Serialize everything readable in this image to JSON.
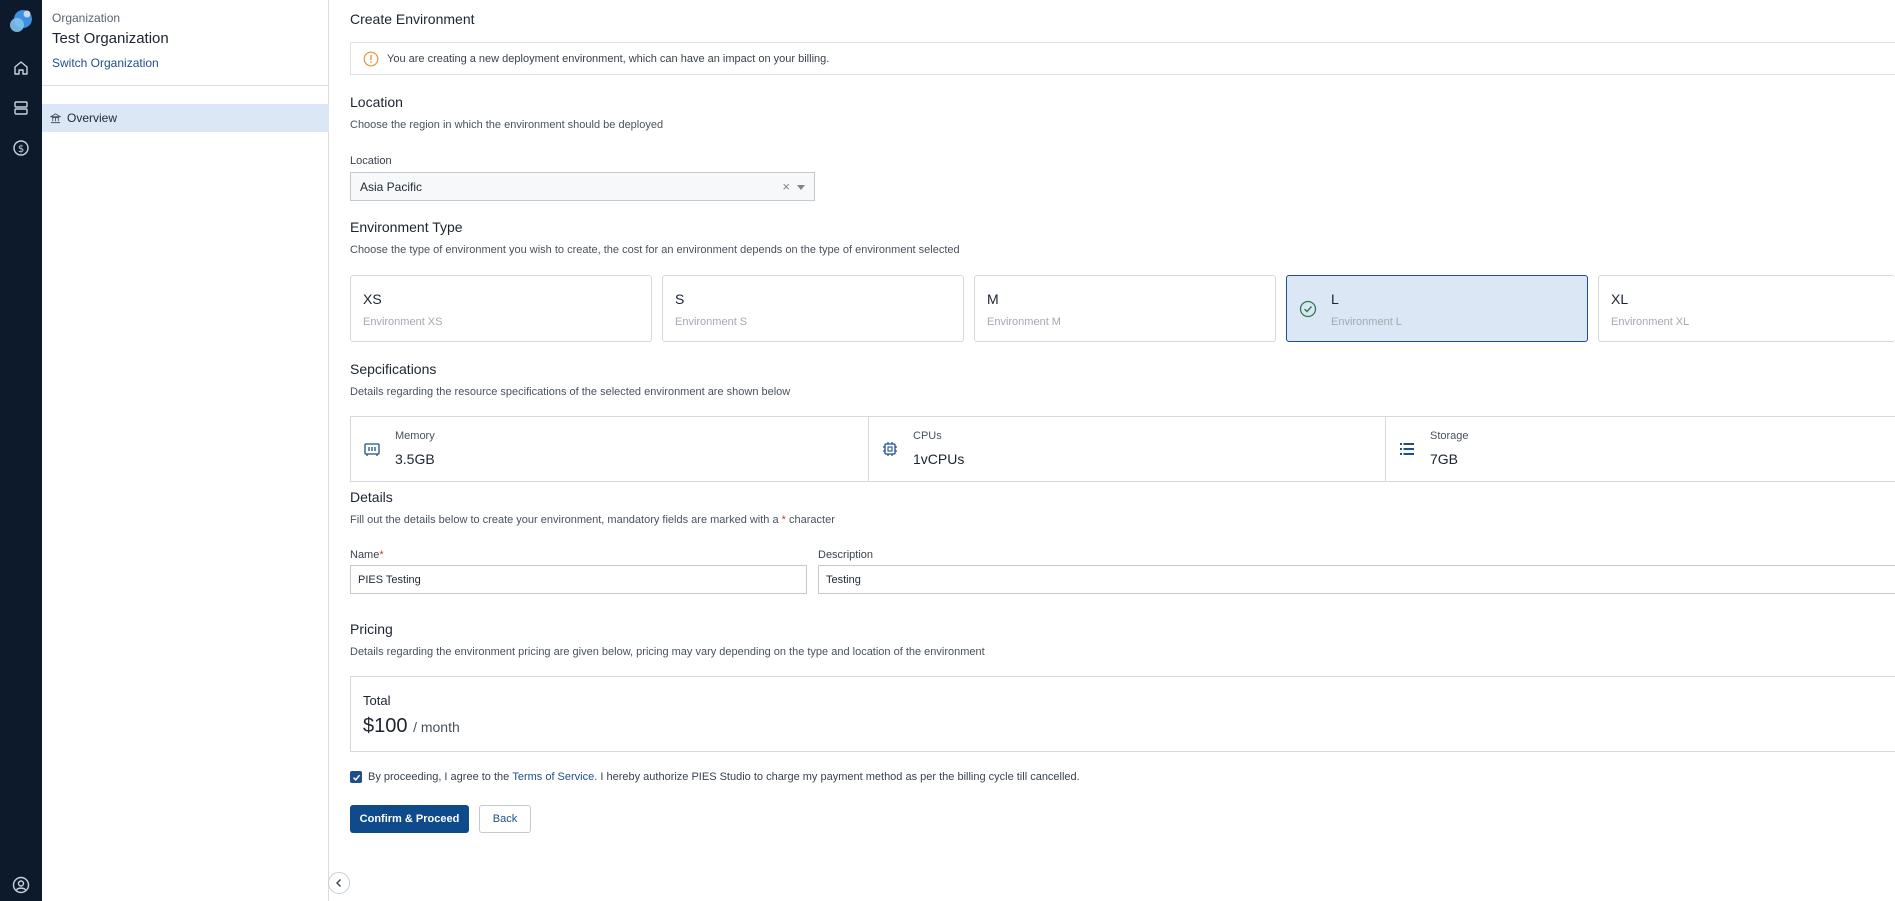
{
  "sidebar": {
    "org_label": "Organization",
    "org_name": "Test Organization",
    "switch_label": "Switch Organization",
    "nav_overview": "Overview"
  },
  "page": {
    "title": "Create Environment",
    "alert": "You are creating a new deployment environment, which can have an impact on your billing."
  },
  "location": {
    "title": "Location",
    "desc": "Choose the region in which the environment should be deployed",
    "field_label": "Location",
    "value": "Asia Pacific",
    "clear": "×"
  },
  "env_type": {
    "title": "Environment Type",
    "desc": "Choose the type of environment you wish to create, the cost for an environment depends on the type of environment selected",
    "options": [
      {
        "name": "XS",
        "sub": "Environment XS"
      },
      {
        "name": "S",
        "sub": "Environment S"
      },
      {
        "name": "M",
        "sub": "Environment M"
      },
      {
        "name": "L",
        "sub": "Environment L"
      },
      {
        "name": "XL",
        "sub": "Environment XL"
      }
    ],
    "selected": "L"
  },
  "specs": {
    "title": "Sepcifications",
    "desc": "Details regarding the resource specifications of the selected environment are shown below",
    "items": [
      {
        "label": "Memory",
        "value": "3.5GB",
        "icon": "memory-icon"
      },
      {
        "label": "CPUs",
        "value": "1vCPUs",
        "icon": "cpu-icon"
      },
      {
        "label": "Storage",
        "value": "7GB",
        "icon": "storage-icon"
      }
    ]
  },
  "details": {
    "title": "Details",
    "desc_prefix": "Fill out the details below to create your environment, mandatory fields are marked with a",
    "required_mark": "*",
    "desc_suffix": "character",
    "name_label": "Name",
    "name_value": "PIES Testing",
    "description_label": "Description",
    "description_value": "Testing"
  },
  "pricing": {
    "title": "Pricing",
    "desc": "Details regarding the environment pricing are given below, pricing may vary depending on the type and location of the environment",
    "total_label": "Total",
    "amount": "$100",
    "period": "/ month"
  },
  "agreement": {
    "prefix": "By proceeding, I agree to the",
    "link": "Terms of Service",
    "suffix": ". I hereby authorize PIES Studio to charge my payment method as per the billing cycle till cancelled.",
    "checked": true
  },
  "actions": {
    "confirm": "Confirm & Proceed",
    "back": "Back"
  },
  "colors": {
    "rail": "#0d1a2b",
    "accent": "#0f4a8a",
    "selected_bg": "#dbe7f5",
    "warning": "#e8913a",
    "required": "#d0342c"
  }
}
